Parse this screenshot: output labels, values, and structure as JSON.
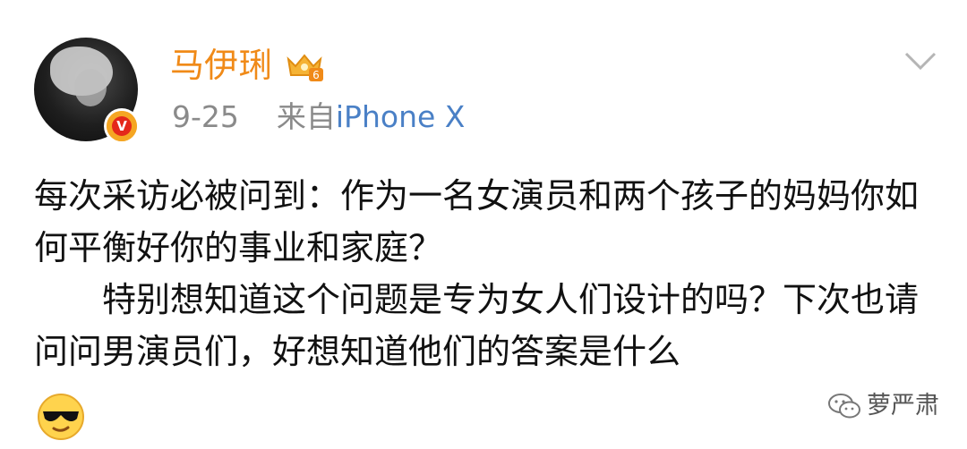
{
  "post": {
    "author": {
      "name": "马伊琍",
      "level_badge": "6"
    },
    "date": "9-25",
    "source_prefix": "来自",
    "source_device": "iPhone X",
    "paragraphs": [
      "每次采访必被问到：作为一名女演员和两个孩子的妈妈你如何平衡好你的事业和家庭？",
      "特别想知道这个问题是专为女人们设计的吗？下次也请问问男演员们，好想知道他们的答案是什么"
    ],
    "trailing_emoji": "cool-sunglasses-emoji"
  },
  "watermark": {
    "text": "萝严肃",
    "icon": "wechat-icon"
  },
  "colors": {
    "username": "#f08a18",
    "source_link": "#4a80c6",
    "meta_gray": "#8a8a8a",
    "verified_red": "#e4281b",
    "verified_gold": "#f5a623"
  }
}
